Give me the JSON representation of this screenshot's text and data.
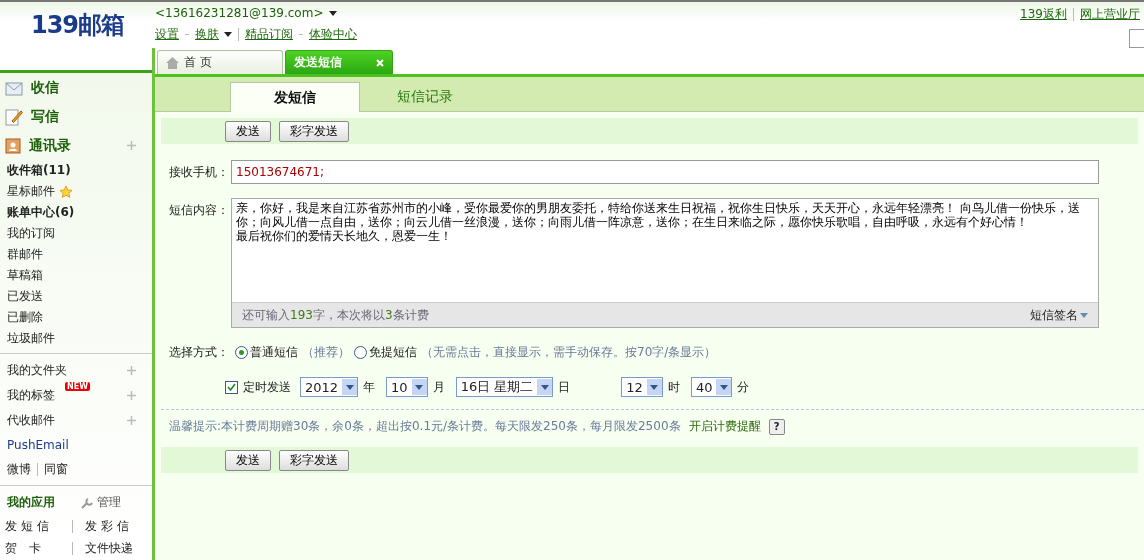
{
  "logo": "139邮箱",
  "account": {
    "email": "<13616231281@139.com>",
    "links": [
      {
        "label": "设置",
        "dropdown": false
      },
      {
        "label": "换肤",
        "dropdown": true
      },
      {
        "label": "精品订阅",
        "dropdown": false
      },
      {
        "label": "体验中心",
        "dropdown": false
      }
    ]
  },
  "top_links": [
    "139返利",
    "网上营业厅"
  ],
  "window_tabs": [
    {
      "label": "首 页",
      "selected": false,
      "closable": false
    },
    {
      "label": "发送短信",
      "selected": true,
      "closable": true
    }
  ],
  "sidebar": {
    "main": [
      {
        "label": "收信",
        "kind": "inbox"
      },
      {
        "label": "写信",
        "kind": "compose"
      },
      {
        "label": "通讯录",
        "kind": "contacts"
      }
    ],
    "folders": [
      {
        "label": "收件箱(11)",
        "bold": true,
        "star": false
      },
      {
        "label": "星标邮件",
        "bold": false,
        "star": true
      },
      {
        "label": "账单中心(6)",
        "bold": true,
        "star": false
      },
      {
        "label": "我的订阅",
        "bold": false,
        "star": false
      },
      {
        "label": "群邮件",
        "bold": false,
        "star": false
      },
      {
        "label": "草稿箱",
        "bold": false,
        "star": false
      },
      {
        "label": "已发送",
        "bold": false,
        "star": false
      },
      {
        "label": "已删除",
        "bold": false,
        "star": false
      },
      {
        "label": "垃圾邮件",
        "bold": false,
        "star": false
      }
    ],
    "groups": [
      {
        "label": "我的文件夹"
      },
      {
        "label": "我的标签",
        "badge": "NEW"
      },
      {
        "label": "代收邮件"
      }
    ],
    "extras": [
      "PushEmail"
    ],
    "social": [
      "微博",
      "同窗"
    ],
    "apps_title": "我的应用",
    "apps_manage": "管理",
    "apps": [
      [
        "发 短 信",
        "发 彩 信"
      ],
      [
        "贺　卡",
        "文件快递"
      ]
    ]
  },
  "sub_tabs": [
    {
      "label": "发短信",
      "selected": true
    },
    {
      "label": "短信记录",
      "selected": false
    }
  ],
  "top_buttons": [
    "发送",
    "彩字发送"
  ],
  "bottom_buttons": [
    "发送",
    "彩字发送"
  ],
  "form": {
    "recipient_label": "接收手机：",
    "recipient": "15013674671;",
    "content_label": "短信内容：",
    "content": [
      "亲，你好，我是来自江苏省苏州市的小峰，受你最爱你的男朋友委托，特给你送来生日祝福，祝你生日快乐，天天开心，永远年轻漂亮！  向鸟儿借一份快乐，送你；向风儿借一点自由，送你；向云儿借一丝浪漫，送你；向雨儿借一阵凉意，送你；在生日来临之际，愿你快乐歌唱，自由呼吸，永远有个好心情！",
      "最后祝你们的爱情天长地久，恩爱一生！"
    ],
    "counter": "还可输入**193**字，本次将以**3**条计费",
    "signature": "短信签名",
    "mode_label": "选择方式：",
    "modes": [
      {
        "label": "普通短信",
        "note": "（推荐）",
        "selected": true
      },
      {
        "label": "免提短信",
        "note": "（无需点击，直接显示，需手动保存。按70字/条显示）",
        "selected": false
      }
    ],
    "schedule": {
      "label": "定时发送",
      "checked": true,
      "fields": [
        {
          "value": "2012",
          "unit": "年"
        },
        {
          "value": "10",
          "unit": "月"
        },
        {
          "value": "16日 星期二",
          "unit": "日"
        },
        {
          "value": "12",
          "unit": "时"
        },
        {
          "value": "40",
          "unit": "分"
        }
      ]
    },
    "tip": "温馨提示:本计费周期赠30条，余0条，超出按0.1元/条计费。每天限发250条，每月限发2500条",
    "tip_link": "开启计费提醒",
    "help": "?"
  }
}
